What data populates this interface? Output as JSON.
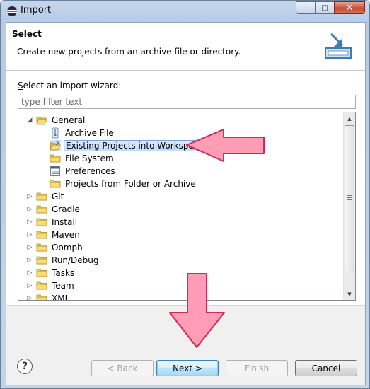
{
  "window": {
    "title": "Import",
    "controls": {
      "minimize": "–",
      "maximize": "□",
      "close": "✕"
    }
  },
  "header": {
    "title": "Select",
    "description": "Create new projects from an archive file or directory.",
    "icon": "import-wizard-icon"
  },
  "wizard": {
    "label": "Select an import wizard:",
    "filter_placeholder": "type filter text",
    "tree": [
      {
        "label": "General",
        "expanded": true,
        "icon": "folder-open-icon"
      },
      {
        "label": "Archive File",
        "icon": "archive-file-icon"
      },
      {
        "label": "Existing Projects into Workspace",
        "icon": "projects-folder-icon",
        "selected": true
      },
      {
        "label": "File System",
        "icon": "folder-icon"
      },
      {
        "label": "Preferences",
        "icon": "preferences-icon"
      },
      {
        "label": "Projects from Folder or Archive",
        "icon": "folder-icon"
      },
      {
        "label": "Git",
        "expanded": false,
        "icon": "folder-icon"
      },
      {
        "label": "Gradle",
        "expanded": false,
        "icon": "folder-icon"
      },
      {
        "label": "Install",
        "expanded": false,
        "icon": "folder-icon"
      },
      {
        "label": "Maven",
        "expanded": false,
        "icon": "folder-icon"
      },
      {
        "label": "Oomph",
        "expanded": false,
        "icon": "folder-icon"
      },
      {
        "label": "Run/Debug",
        "expanded": false,
        "icon": "folder-icon"
      },
      {
        "label": "Tasks",
        "expanded": false,
        "icon": "folder-icon"
      },
      {
        "label": "Team",
        "expanded": false,
        "icon": "folder-icon"
      },
      {
        "label": "XML",
        "expanded": false,
        "icon": "folder-icon"
      }
    ]
  },
  "buttons": {
    "help": "?",
    "back": "< Back",
    "next": "Next >",
    "finish": "Finish",
    "cancel": "Cancel"
  },
  "annotation_color": "#ff9cb6",
  "annotation_stroke": "#d4275c"
}
